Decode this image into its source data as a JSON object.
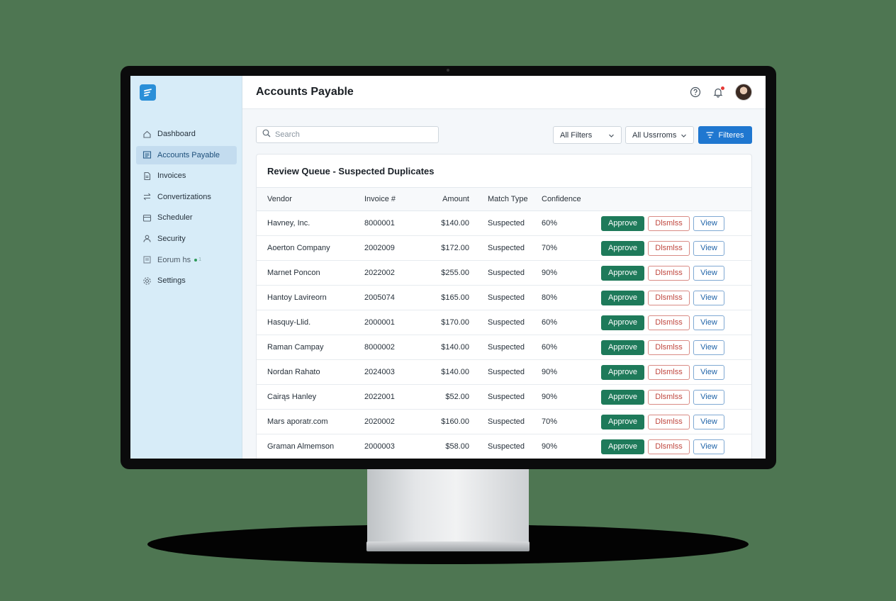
{
  "sidebar": {
    "items": [
      {
        "label": "Dashboard",
        "icon": "home-icon"
      },
      {
        "label": "Accounts Payable",
        "icon": "accounts-icon",
        "active": true
      },
      {
        "label": "Invoices",
        "icon": "document-icon"
      },
      {
        "label": "Convertizations",
        "icon": "arrows-icon"
      },
      {
        "label": "Scheduler",
        "icon": "calendar-icon"
      },
      {
        "label": "Security",
        "icon": "user-icon"
      },
      {
        "label": "Eorum hs",
        "icon": "forum-icon",
        "badge": "1"
      },
      {
        "label": "Settings",
        "icon": "gear-icon"
      }
    ]
  },
  "header": {
    "title": "Accounts Payable"
  },
  "toolbar": {
    "search_placeholder": "Search",
    "filter1": "All Filters",
    "filter2": "All Ussrroms",
    "filter_button": "Filteres"
  },
  "queue": {
    "title": "Review Queue - Suspected Duplicates",
    "columns": [
      "Vendor",
      "Invoice #",
      "Amount",
      "Match Type",
      "Confidence"
    ],
    "actions": {
      "approve": "Approve",
      "dismiss": "Dlsmlss",
      "view": "View"
    },
    "rows": [
      {
        "vendor": "Havney, Inc.",
        "invoice": "8000001",
        "amount": "$140.00",
        "match": "Suspected",
        "confidence": "60%"
      },
      {
        "vendor": "Aoerton Company",
        "invoice": "2002009",
        "amount": "$172.00",
        "match": "Suspected",
        "confidence": "70%"
      },
      {
        "vendor": "Marnet Poncon",
        "invoice": "2022002",
        "amount": "$255.00",
        "match": "Suspected",
        "confidence": "90%"
      },
      {
        "vendor": "Hantoy Lavireorn",
        "invoice": "2005074",
        "amount": "$165.00",
        "match": "Suspected",
        "confidence": "80%"
      },
      {
        "vendor": "Hasquy-Llid.",
        "invoice": "2000001",
        "amount": "$170.00",
        "match": "Suspected",
        "confidence": "60%"
      },
      {
        "vendor": "Raman Campay",
        "invoice": "8000002",
        "amount": "$140.00",
        "match": "Suspected",
        "confidence": "60%"
      },
      {
        "vendor": "Nordan Rahato",
        "invoice": "2024003",
        "amount": "$140.00",
        "match": "Suspected",
        "confidence": "90%"
      },
      {
        "vendor": "Cairąs Hanley",
        "invoice": "2022001",
        "amount": "$52.00",
        "match": "Suspected",
        "confidence": "90%"
      },
      {
        "vendor": "Mars aporatr.com",
        "invoice": "2020002",
        "amount": "$160.00",
        "match": "Suspected",
        "confidence": "70%"
      },
      {
        "vendor": "Graman Almemson",
        "invoice": "2000003",
        "amount": "$58.00",
        "match": "Suspected",
        "confidence": "90%"
      }
    ]
  },
  "colors": {
    "accent": "#1f77d0",
    "approve": "#1e7a5a",
    "dismiss": "#c0473f",
    "sidebar_bg": "#d7ecf8",
    "notification_dot": "#e53935"
  }
}
